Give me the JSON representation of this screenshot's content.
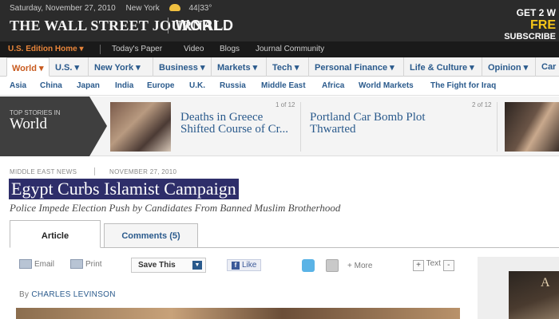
{
  "masthead": {
    "date": "Saturday, November 27, 2010",
    "city": "New York",
    "weather": "44|33°",
    "logo": "THE WALL STREET JOURNAL.",
    "section": "WORLD",
    "promo": {
      "line1": "GET 2 W",
      "line2": "FRE",
      "line3": "SUBSCRIBE"
    }
  },
  "edition_bar": {
    "edition": "U.S. Edition Home ▾",
    "links": [
      "Today's Paper",
      "Video",
      "Blogs",
      "Journal Community"
    ]
  },
  "main_nav": [
    {
      "label": "World ▾"
    },
    {
      "label": "U.S. ▾"
    },
    {
      "label": "New York ▾"
    },
    {
      "label": "Business ▾"
    },
    {
      "label": "Markets ▾"
    },
    {
      "label": "Tech ▾"
    },
    {
      "label": "Personal Finance ▾"
    },
    {
      "label": "Life & Culture ▾"
    },
    {
      "label": "Opinion ▾"
    },
    {
      "label": "Car"
    }
  ],
  "sub_nav": [
    "Asia",
    "China",
    "Japan",
    "India",
    "Europe",
    "U.K.",
    "Russia",
    "Middle East",
    "Africa",
    "World Markets",
    "The Fight for Iraq"
  ],
  "top_stories": {
    "label_small": "TOP STORIES IN",
    "label_big": "World",
    "stories": [
      {
        "headline": "Deaths in Greece Shifted Course of Cr...",
        "count": "1 of 12"
      },
      {
        "headline": "Portland Car Bomb Plot Thwarted",
        "count": "2 of 12"
      }
    ]
  },
  "article": {
    "kicker": "MIDDLE EAST NEWS",
    "date": "NOVEMBER 27, 2010",
    "title": "Egypt Curbs Islamist Campaign",
    "deck": "Police Impede Election Push by Candidates From Banned Muslim Brotherhood",
    "tabs": [
      "Article",
      "Comments (5)"
    ],
    "byline_prefix": "By",
    "author": "CHARLES LEVINSON"
  },
  "toolbar": {
    "email": "Email",
    "print": "Print",
    "save": "Save This",
    "like": "Like",
    "more": "+ More",
    "text": "Text",
    "text_plus": "+",
    "text_minus": "-"
  },
  "ad": {
    "text": "A"
  },
  "colors": {
    "accent": "#c85a1e",
    "link": "#2a5a8c",
    "title_highlight": "#2e2e6a"
  }
}
